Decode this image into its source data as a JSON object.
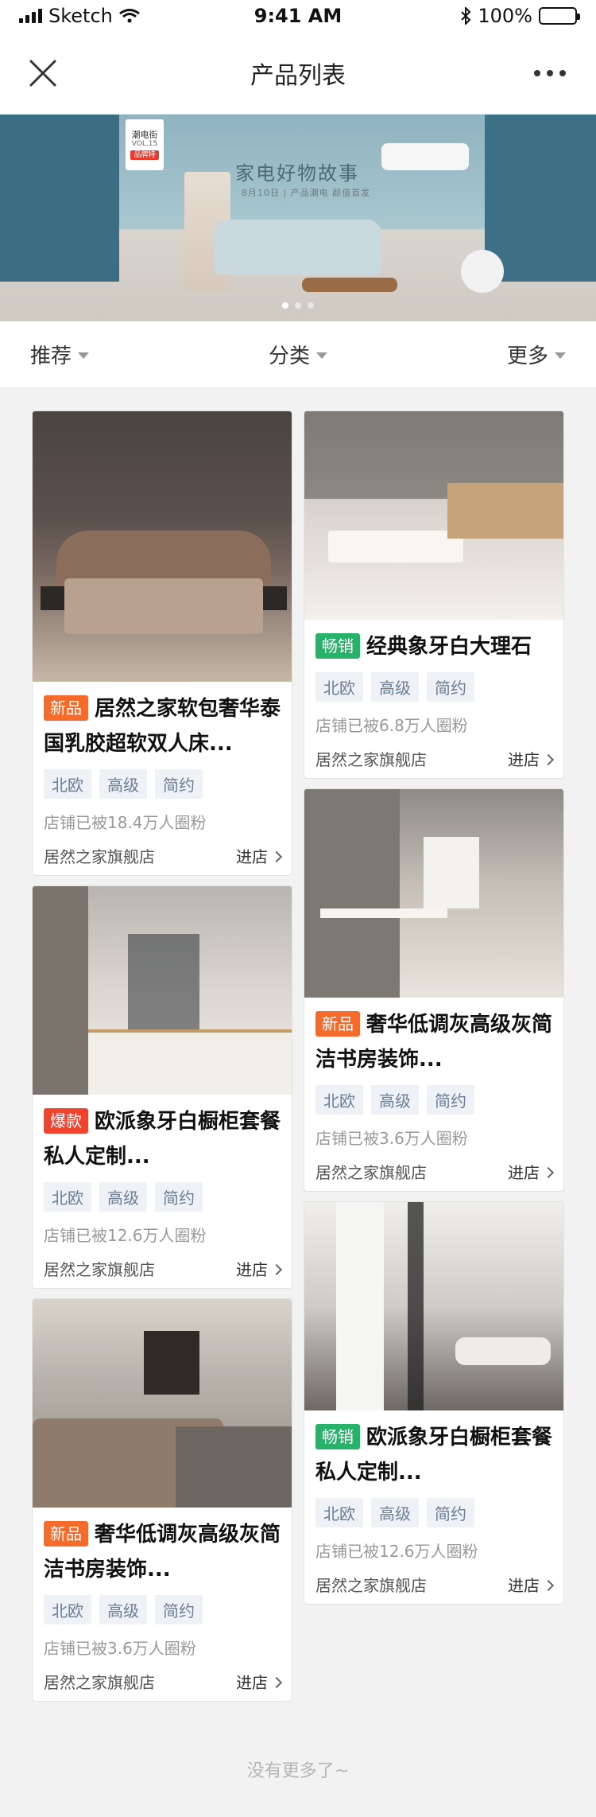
{
  "status": {
    "carrier": "Sketch",
    "time": "9:41 AM",
    "battery": "100%"
  },
  "nav": {
    "title": "产品列表"
  },
  "banner": {
    "title": "家电好物故事",
    "subtitle": "8月10日 | 产品潮电 颜值首发",
    "promo_line1": "潮电街",
    "promo_vol": "VOL.15",
    "promo_tag": "品牌特"
  },
  "filters": [
    {
      "label": "推荐"
    },
    {
      "label": "分类"
    },
    {
      "label": "更多"
    }
  ],
  "products": [
    {
      "badge": "新品",
      "badge_color": "#f46b2b",
      "title": "居然之家软包奢华泰国乳胶超软双人床...",
      "tags": [
        "北欧",
        "高级",
        "简约"
      ],
      "fans": "店铺已被18.4万人圈粉",
      "store": "居然之家旗舰店",
      "enter": "进店"
    },
    {
      "badge": "畅销",
      "badge_color": "#27b26a",
      "title": "经典象牙白大理石",
      "tags": [
        "北欧",
        "高级",
        "简约"
      ],
      "fans": "店铺已被6.8万人圈粉",
      "store": "居然之家旗舰店",
      "enter": "进店"
    },
    {
      "badge": "爆款",
      "badge_color": "#f0442f",
      "title": "欧派象牙白橱柜套餐私人定制...",
      "tags": [
        "北欧",
        "高级",
        "简约"
      ],
      "fans": "店铺已被12.6万人圈粉",
      "store": "居然之家旗舰店",
      "enter": "进店"
    },
    {
      "badge": "新品",
      "badge_color": "#f46b2b",
      "title": "奢华低调灰高级灰简洁书房装饰...",
      "tags": [
        "北欧",
        "高级",
        "简约"
      ],
      "fans": "店铺已被3.6万人圈粉",
      "store": "居然之家旗舰店",
      "enter": "进店"
    },
    {
      "badge": "新品",
      "badge_color": "#f46b2b",
      "title": "奢华低调灰高级灰简洁书房装饰...",
      "tags": [
        "北欧",
        "高级",
        "简约"
      ],
      "fans": "店铺已被3.6万人圈粉",
      "store": "居然之家旗舰店",
      "enter": "进店"
    },
    {
      "badge": "畅销",
      "badge_color": "#27b26a",
      "title": "欧派象牙白橱柜套餐私人定制...",
      "tags": [
        "北欧",
        "高级",
        "简约"
      ],
      "fans": "店铺已被12.6万人圈粉",
      "store": "居然之家旗舰店",
      "enter": "进店"
    }
  ],
  "footer": {
    "no_more": "没有更多了~"
  }
}
